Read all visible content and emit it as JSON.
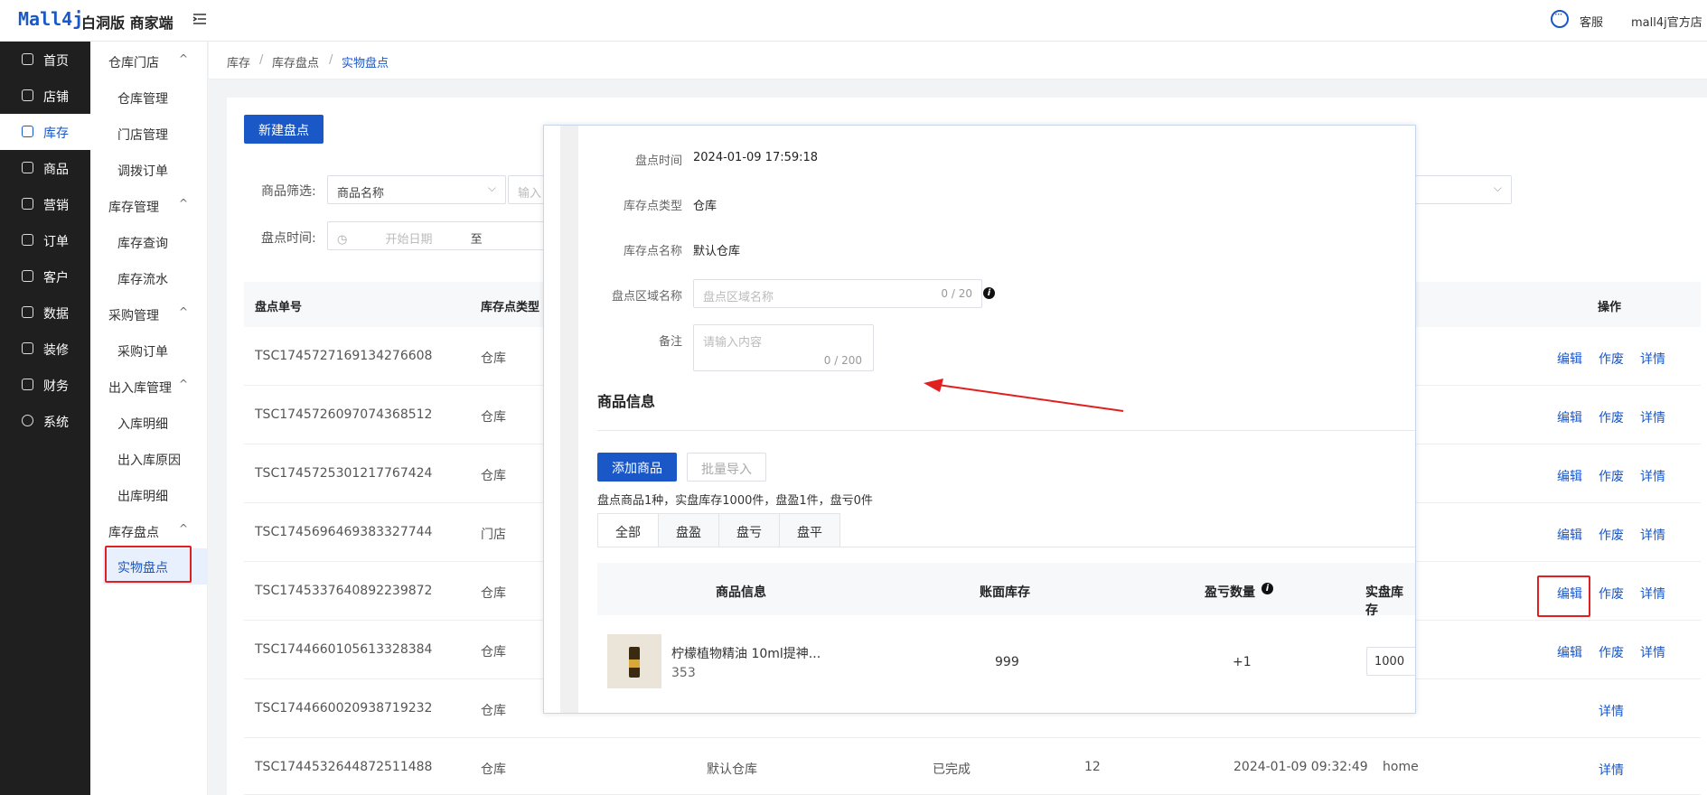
{
  "topbar": {
    "logo": "Mall4j",
    "brand": "白洞版 商家端",
    "service_label": "客服",
    "shop_name": "mall4j官方店"
  },
  "sidenav": {
    "items": [
      {
        "label": "首页",
        "icon": "home-icon"
      },
      {
        "label": "店铺",
        "icon": "shop-icon"
      },
      {
        "label": "库存",
        "icon": "inventory-icon",
        "active": true
      },
      {
        "label": "商品",
        "icon": "product-icon"
      },
      {
        "label": "营销",
        "icon": "gift-icon"
      },
      {
        "label": "订单",
        "icon": "order-icon"
      },
      {
        "label": "客户",
        "icon": "customer-icon"
      },
      {
        "label": "数据",
        "icon": "data-icon"
      },
      {
        "label": "装修",
        "icon": "decorate-icon"
      },
      {
        "label": "财务",
        "icon": "finance-icon"
      },
      {
        "label": "系统",
        "icon": "settings-icon"
      }
    ]
  },
  "subnav": {
    "groups": [
      {
        "label": "仓库门店",
        "items": [
          "仓库管理",
          "门店管理",
          "调拨订单"
        ]
      },
      {
        "label": "库存管理",
        "items": [
          "库存查询",
          "库存流水"
        ]
      },
      {
        "label": "采购管理",
        "items": [
          "采购订单"
        ]
      },
      {
        "label": "出入库管理",
        "items": [
          "入库明细",
          "出入库原因",
          "出库明细"
        ]
      },
      {
        "label": "库存盘点",
        "items": [
          "实物盘点"
        ]
      }
    ],
    "chevron": "^"
  },
  "breadcrumb": [
    "库存",
    "库存盘点",
    "实物盘点"
  ],
  "breadcrumb_sep": "/",
  "toolbar": {
    "new_button": "新建盘点"
  },
  "filters": {
    "product_label": "商品筛选:",
    "product_select": "商品名称",
    "product_input_placeholder": "输入",
    "time_label": "盘点时间:",
    "start_placeholder": "开始日期",
    "to": "至"
  },
  "table": {
    "headers": [
      "盘点单号",
      "库存点类型",
      "操作"
    ],
    "rows": [
      {
        "id": "TSC1745727169134276608",
        "type": "仓库",
        "actions": [
          "编辑",
          "作废",
          "详情"
        ]
      },
      {
        "id": "TSC1745726097074368512",
        "type": "仓库",
        "actions": [
          "编辑",
          "作废",
          "详情"
        ]
      },
      {
        "id": "TSC1745725301217767424",
        "type": "仓库",
        "actions": [
          "编辑",
          "作废",
          "详情"
        ]
      },
      {
        "id": "TSC1745696469383327744",
        "type": "门店",
        "actions": [
          "编辑",
          "作废",
          "详情"
        ]
      },
      {
        "id": "TSC1745337640892239872",
        "type": "仓库",
        "actions": [
          "编辑",
          "作废",
          "详情"
        ]
      },
      {
        "id": "TSC1744660105613328384",
        "type": "仓库",
        "actions": [
          "编辑",
          "作废",
          "详情"
        ]
      },
      {
        "id": "TSC1744660020938719232",
        "type": "仓库",
        "actions": [
          "详情"
        ]
      },
      {
        "id": "TSC1744532644872511488",
        "type": "仓库",
        "point": "默认仓库",
        "status": "已完成",
        "qty": "12",
        "time": "2024-01-09 09:32:49",
        "user": "home",
        "actions": [
          "详情"
        ]
      }
    ]
  },
  "modal": {
    "time_label": "盘点时间",
    "time_value": "2024-01-09 17:59:18",
    "type_label": "库存点类型",
    "type_value": "仓库",
    "name_label": "库存点名称",
    "name_value": "默认仓库",
    "area_label": "盘点区域名称",
    "area_placeholder": "盘点区域名称",
    "area_count": "0 / 20",
    "note_label": "备注",
    "note_placeholder": "请输入内容",
    "note_count": "0 / 200",
    "section_title": "商品信息",
    "add_button": "添加商品",
    "import_button": "批量导入",
    "summary": "盘点商品1种，实盘库存1000件，盘盈1件，盘亏0件",
    "tabs": [
      "全部",
      "盘盈",
      "盘亏",
      "盘平"
    ],
    "columns": [
      "商品信息",
      "账面库存",
      "盈亏数量",
      "实盘库存"
    ],
    "item": {
      "name": "柠檬植物精油 10ml提神...",
      "code": "353",
      "book_stock": "999",
      "diff": "+1",
      "actual": "1000"
    }
  },
  "colors": {
    "primary": "#1a57c7",
    "highlight": "#e02020",
    "sidebar": "#1f1f1f"
  }
}
